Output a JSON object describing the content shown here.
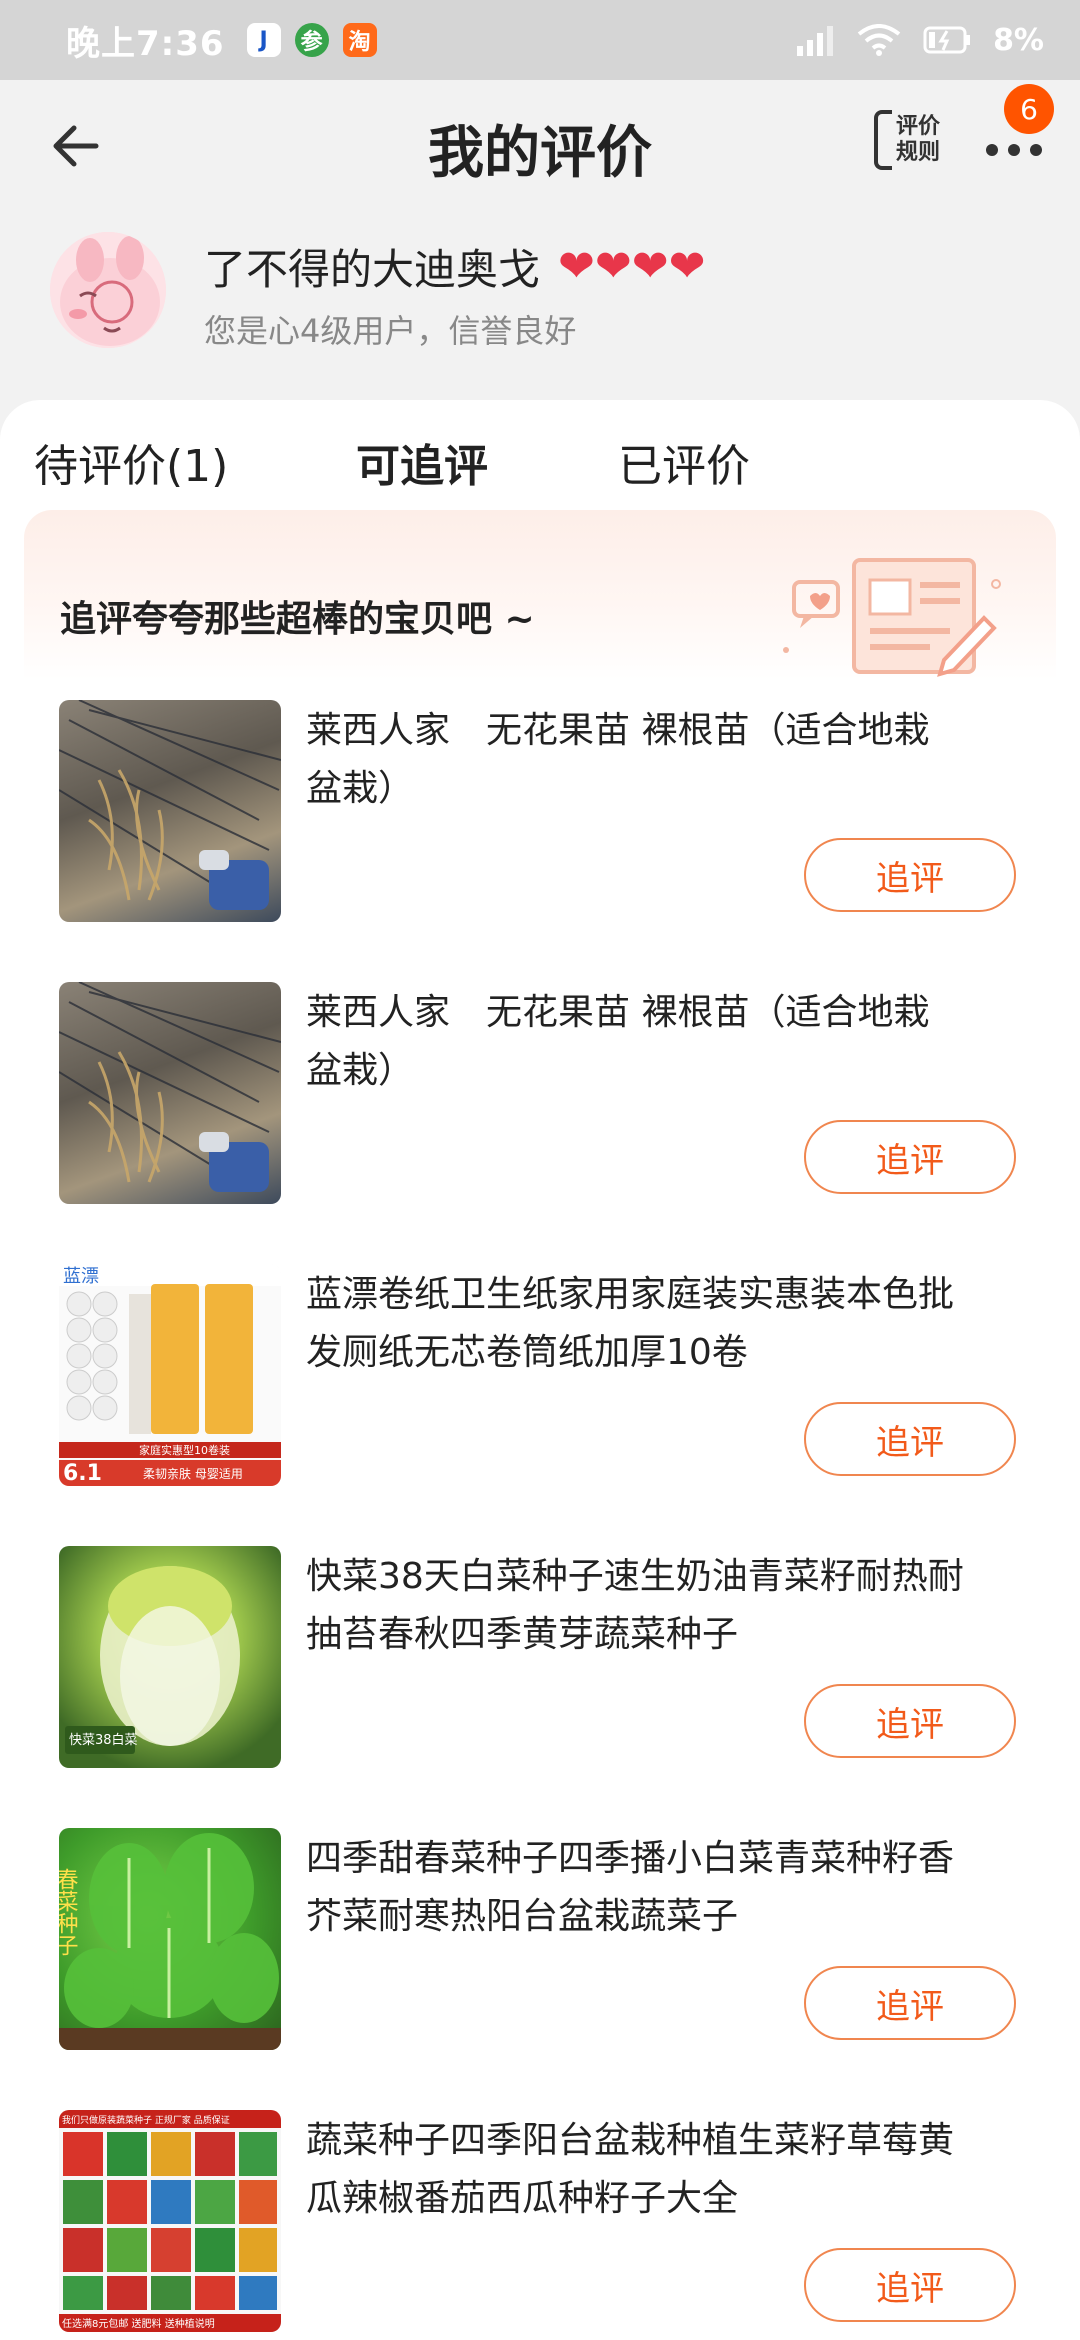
{
  "status_bar": {
    "time": "晚上7:36",
    "apps": [
      "J",
      "参",
      "淘"
    ],
    "battery": "8%"
  },
  "header": {
    "title": "我的评价",
    "rules_label_line1": "评价",
    "rules_label_line2": "规则",
    "badge_count": "6"
  },
  "user": {
    "name": "了不得的大迪奥戈",
    "hearts": 4,
    "level_text": "您是心4级用户，信誉良好"
  },
  "tabs": [
    {
      "label": "待评价(1)",
      "active": false
    },
    {
      "label": "可追评",
      "active": true
    },
    {
      "label": "已评价",
      "active": false
    }
  ],
  "card": {
    "title": "追评夸夸那些超棒的宝贝吧 ~"
  },
  "items": [
    {
      "title": "莱西人家　无花果苗  裸根苗（适合地栽 盆栽）",
      "button": "追评",
      "thumb": "fig-seedlings"
    },
    {
      "title": "莱西人家　无花果苗  裸根苗（适合地栽 盆栽）",
      "button": "追评",
      "thumb": "fig-seedlings"
    },
    {
      "title": "蓝漂卷纸卫生纸家用家庭装实惠装本色批发厕纸无芯卷筒纸加厚10卷",
      "button": "追评",
      "thumb": "toilet-paper"
    },
    {
      "title": "快菜38天白菜种子速生奶油青菜籽耐热耐抽苔春秋四季黄芽蔬菜种子",
      "button": "追评",
      "thumb": "napa-cabbage"
    },
    {
      "title": "四季甜春菜种子四季播小白菜青菜种籽香芥菜耐寒热阳台盆栽蔬菜子",
      "button": "追评",
      "thumb": "green-vegetables"
    },
    {
      "title": "蔬菜种子四季阳台盆栽种植生菜籽草莓黄瓜辣椒番茄西瓜种籽子大全",
      "button": "追评",
      "thumb": "seed-packets"
    }
  ],
  "thumb_text": {
    "paper_brand": "蓝漂",
    "paper_price": "6.1",
    "paper_tag": "家庭实惠型10卷装",
    "paper_sub": "柔韧亲肤  母婴适用",
    "cabbage_tag": "快菜38白菜",
    "greens_tag": "春菜种子",
    "seeds_top": "我们只做原装蔬菜种子 正规厂家 品质保证",
    "seeds_bottom": "任选满8元包邮  送肥料 送种植说明"
  },
  "colors": {
    "accent": "#f25a1a",
    "badge": "#ff5400",
    "heart": "#e8364a"
  }
}
